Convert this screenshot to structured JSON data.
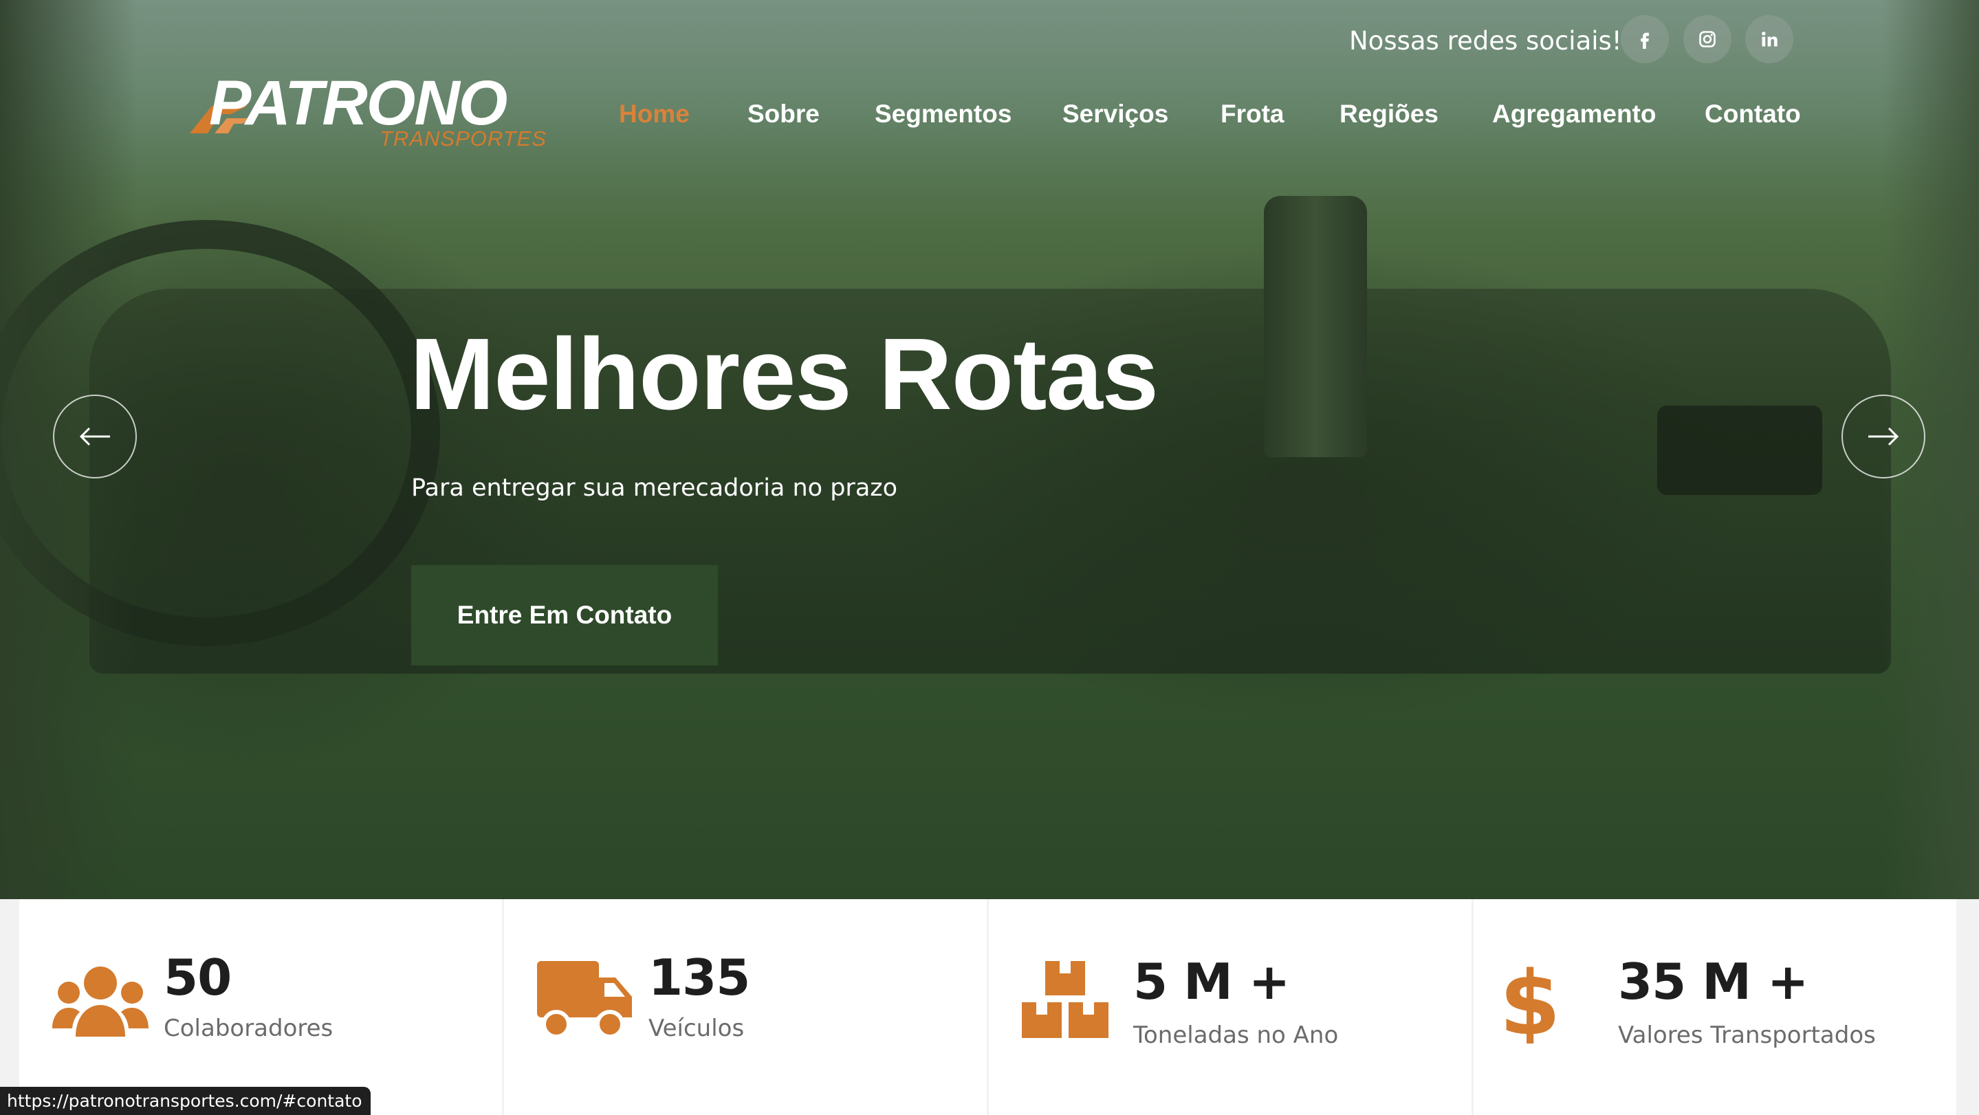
{
  "header": {
    "social_label": "Nossas redes sociais!",
    "social_icons": [
      "facebook-icon",
      "instagram-icon",
      "linkedin-icon"
    ],
    "logo": {
      "word": "PATRONO",
      "sub": "TRANSPORTES"
    },
    "nav": [
      "Home",
      "Sobre",
      "Segmentos",
      "Serviços",
      "Frota",
      "Regiões",
      "Agregamento",
      "Contato"
    ],
    "active_nav": "Home"
  },
  "hero": {
    "title": "Melhores Rotas",
    "subtitle": "Para entregar sua merecadoria no prazo",
    "cta": "Entre Em Contato"
  },
  "stats": [
    {
      "icon": "people-icon",
      "value": "50",
      "label": "Colaboradores"
    },
    {
      "icon": "truck-icon",
      "value": "135",
      "label": "Veículos"
    },
    {
      "icon": "boxes-icon",
      "value": "5 M +",
      "label": "Toneladas no Ano"
    },
    {
      "icon": "dollar-icon",
      "value": "35 M +",
      "label": "Valores Transportados"
    }
  ],
  "status_url": "https://patronotransportes.com/#contato",
  "colors": {
    "accent": "#d47b2e",
    "cta_bg": "#2e4a2a",
    "overlay": "#3e5a35"
  }
}
